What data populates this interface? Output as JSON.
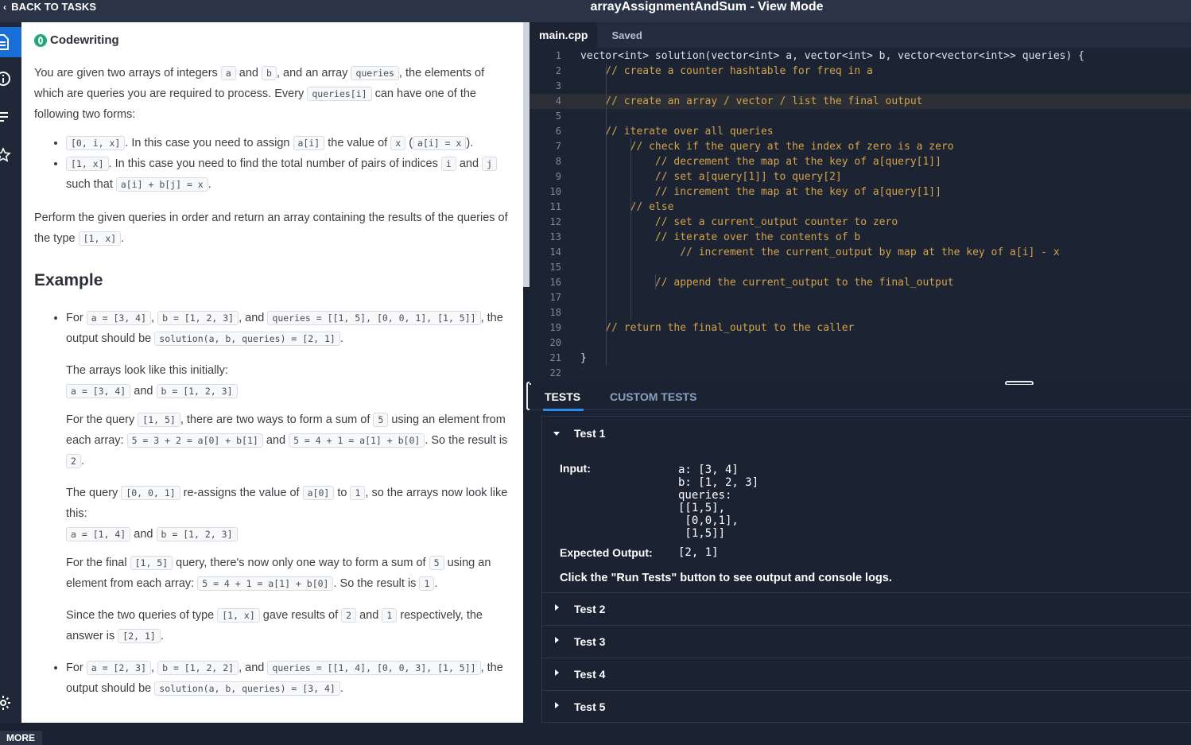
{
  "topbar": {
    "back_label": "BACK TO TASKS",
    "title": "arrayAssignmentAndSum - View Mode"
  },
  "rail": {
    "icons": [
      "document-icon",
      "info-icon",
      "list-icon",
      "star-icon",
      "gear-icon"
    ]
  },
  "problem": {
    "header": "Codewriting",
    "intro": {
      "t1": "You are given two arrays of integers ",
      "c1": "a",
      "t2": " and ",
      "c2": "b",
      "t3": ", and an array ",
      "c3": "queries",
      "t4": ", the elements of which are queries you are required to process. Every ",
      "c4": "queries[i]",
      "t5": " can have one of the following two forms:"
    },
    "forms": [
      {
        "c1": "[0, i, x]",
        "t1": ". In this case you need to assign ",
        "c2": "a[i]",
        "t2": " the value of ",
        "c3": "x",
        "t3": " (",
        "c4": "a[i] = x",
        "t4": ")."
      },
      {
        "c1": "[1, x]",
        "t1": ". In this case you need to find the total number of pairs of indices ",
        "c2": "i",
        "t2": " and ",
        "c3": "j",
        "t3": " such that ",
        "c4": "a[i] + b[j] = x",
        "t4": "."
      }
    ],
    "perform": {
      "t1": "Perform the given queries in order and return an array containing the results of the queries of the type ",
      "c1": "[1, x]",
      "t2": "."
    },
    "example_heading": "Example",
    "ex1": {
      "t1": "For ",
      "c1": "a = [3, 4]",
      "t2": ", ",
      "c2": "b = [1, 2, 3]",
      "t3": ", and ",
      "c3": "queries = [[1, 5], [0, 0, 1], [1, 5]]",
      "t4": ", the output should be ",
      "c4": "solution(a, b, queries) = [2, 1]",
      "t5": ".",
      "p1": "The arrays look like this initially:",
      "p2": {
        "c1": "a = [3, 4]",
        "t1": " and ",
        "c2": "b = [1, 2, 3]"
      },
      "p3": {
        "t1": "For the query ",
        "c1": "[1, 5]",
        "t2": ", there are two ways to form a sum of ",
        "c2": "5",
        "t3": " using an element from each array: ",
        "c3": "5 = 3 + 2 = a[0] + b[1]",
        "t4": " and ",
        "c4": "5 = 4 + 1 = a[1] + b[0]",
        "t5": ". So the result is ",
        "c5": "2",
        "t6": "."
      },
      "p4": {
        "t1": "The query ",
        "c1": "[0, 0, 1]",
        "t2": " re-assigns the value of ",
        "c2": "a[0]",
        "t3": " to ",
        "c3": "1",
        "t4": ", so the arrays now look like this:"
      },
      "p5": {
        "c1": "a = [1, 4]",
        "t1": " and ",
        "c2": "b = [1, 2, 3]"
      },
      "p6": {
        "t1": "For the final ",
        "c1": "[1, 5]",
        "t2": " query, there's now only one way to form a sum of ",
        "c2": "5",
        "t3": " using an element from each array: ",
        "c3": "5 = 4 + 1 = a[1] + b[0]",
        "t4": ". So the result is ",
        "c4": "1",
        "t5": "."
      },
      "p7": {
        "t1": "Since the two queries of type ",
        "c1": "[1, x]",
        "t2": " gave results of ",
        "c2": "2",
        "t3": " and ",
        "c3": "1",
        "t4": " respectively, the answer is ",
        "c4": "[2, 1]",
        "t5": "."
      }
    },
    "ex2": {
      "t1": "For ",
      "c1": "a = [2, 3]",
      "t2": ", ",
      "c2": "b = [1, 2, 2]",
      "t3": ", and ",
      "c3": "queries = [[1, 4], [0, 0, 3], [1, 5]]",
      "t4": ", the output should be ",
      "c4": "solution(a, b, queries) = [3, 4]",
      "t5": "."
    }
  },
  "editor": {
    "tab": "main.cpp",
    "saved": "Saved",
    "lines": [
      {
        "n": "1",
        "code": "vector<int> solution(vector<int> a, vector<int> b, vector<vector<int>> queries) {"
      },
      {
        "n": "2",
        "code": "    // create a counter hashtable for freq in a"
      },
      {
        "n": "3",
        "code": ""
      },
      {
        "n": "4",
        "code": "    // create an array / vector / list the final output"
      },
      {
        "n": "5",
        "code": ""
      },
      {
        "n": "6",
        "code": "    // iterate over all queries"
      },
      {
        "n": "7",
        "code": "        // check if the query at the index of zero is a zero"
      },
      {
        "n": "8",
        "code": "            // decrement the map at the key of a[query[1]]"
      },
      {
        "n": "9",
        "code": "            // set a[query[1]] to query[2]"
      },
      {
        "n": "10",
        "code": "            // increment the map at the key of a[query[1]]"
      },
      {
        "n": "11",
        "code": "        // else"
      },
      {
        "n": "12",
        "code": "            // set a current_output counter to zero"
      },
      {
        "n": "13",
        "code": "            // iterate over the contents of b"
      },
      {
        "n": "14",
        "code": "                // increment the current_output by map at the key of a[i] - x"
      },
      {
        "n": "15",
        "code": ""
      },
      {
        "n": "16",
        "code": "            // append the current_output to the final_output"
      },
      {
        "n": "17",
        "code": ""
      },
      {
        "n": "18",
        "code": ""
      },
      {
        "n": "19",
        "code": "    // return the final_output to the caller"
      },
      {
        "n": "20",
        "code": ""
      },
      {
        "n": "21",
        "code": "}"
      },
      {
        "n": "22",
        "code": ""
      }
    ]
  },
  "tests": {
    "tab_tests": "TESTS",
    "tab_custom": "CUSTOM TESTS",
    "test1": {
      "label": "Test 1",
      "input_label": "Input:",
      "input_value": "a: [3, 4]\nb: [1, 2, 3]\nqueries:\n[[1,5],\n [0,0,1],\n [1,5]]",
      "expected_label": "Expected Output:",
      "expected_value": "[2, 1]",
      "hint": "Click the \"Run Tests\" button to see output and console logs."
    },
    "others": [
      "Test 2",
      "Test 3",
      "Test 4",
      "Test 5"
    ]
  },
  "bottom": {
    "more_label": "MORE"
  },
  "colors": {
    "accent": "#1a6ed8",
    "test_tab_underline": "#2a8bf2",
    "comment": "#d4a24a",
    "keyword": "#6bb3e8"
  }
}
